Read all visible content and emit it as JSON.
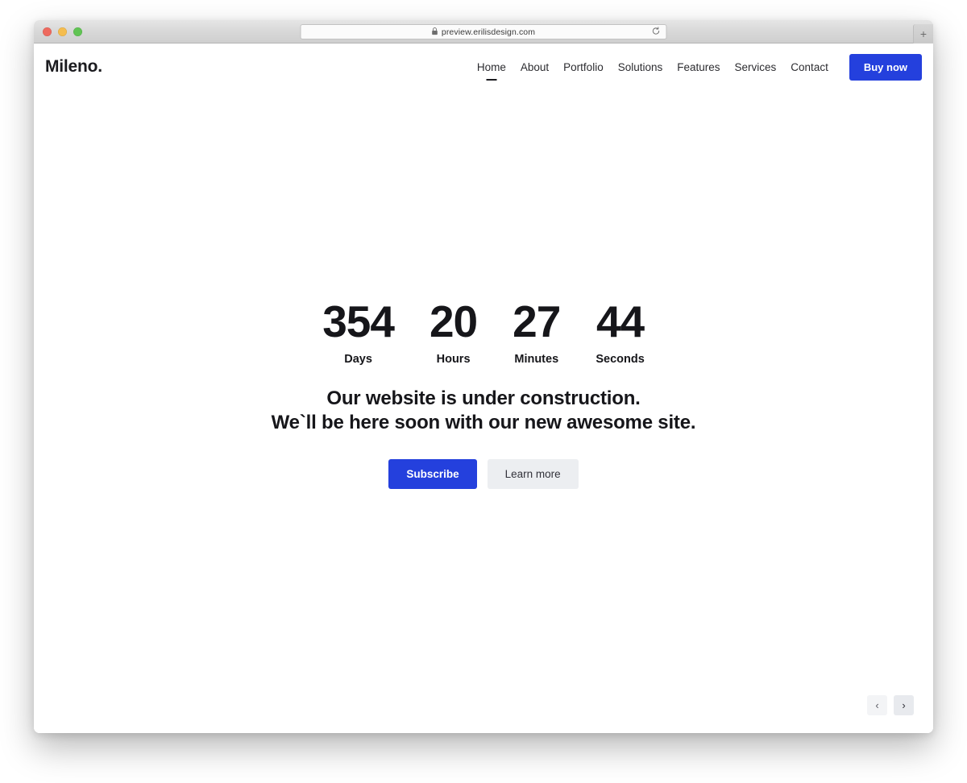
{
  "browser": {
    "url": "preview.erilisdesign.com",
    "lock_icon": "lock-icon",
    "reload_icon": "reload-icon",
    "new_tab_label": "+",
    "traffic_lights": [
      "close",
      "minimize",
      "maximize"
    ]
  },
  "site": {
    "logo": "Mileno.",
    "nav": [
      {
        "label": "Home",
        "active": true
      },
      {
        "label": "About",
        "active": false
      },
      {
        "label": "Portfolio",
        "active": false
      },
      {
        "label": "Solutions",
        "active": false
      },
      {
        "label": "Features",
        "active": false
      },
      {
        "label": "Services",
        "active": false
      },
      {
        "label": "Contact",
        "active": false
      }
    ],
    "buy_now_label": "Buy now"
  },
  "hero": {
    "countdown": [
      {
        "value": "354",
        "label": "Days"
      },
      {
        "value": "20",
        "label": "Hours"
      },
      {
        "value": "27",
        "label": "Minutes"
      },
      {
        "value": "44",
        "label": "Seconds"
      }
    ],
    "headline_line1": "Our website is under construction.",
    "headline_line2": "We`ll be here soon with our new awesome site.",
    "primary_cta": "Subscribe",
    "secondary_cta": "Learn more"
  },
  "slider": {
    "prev_icon": "chevron-left-icon",
    "next_icon": "chevron-right-icon",
    "prev_glyph": "‹",
    "next_glyph": "›"
  },
  "colors": {
    "accent_blue": "#2440dd",
    "text_dark": "#16161a",
    "secondary_btn_bg": "#eceef1"
  }
}
